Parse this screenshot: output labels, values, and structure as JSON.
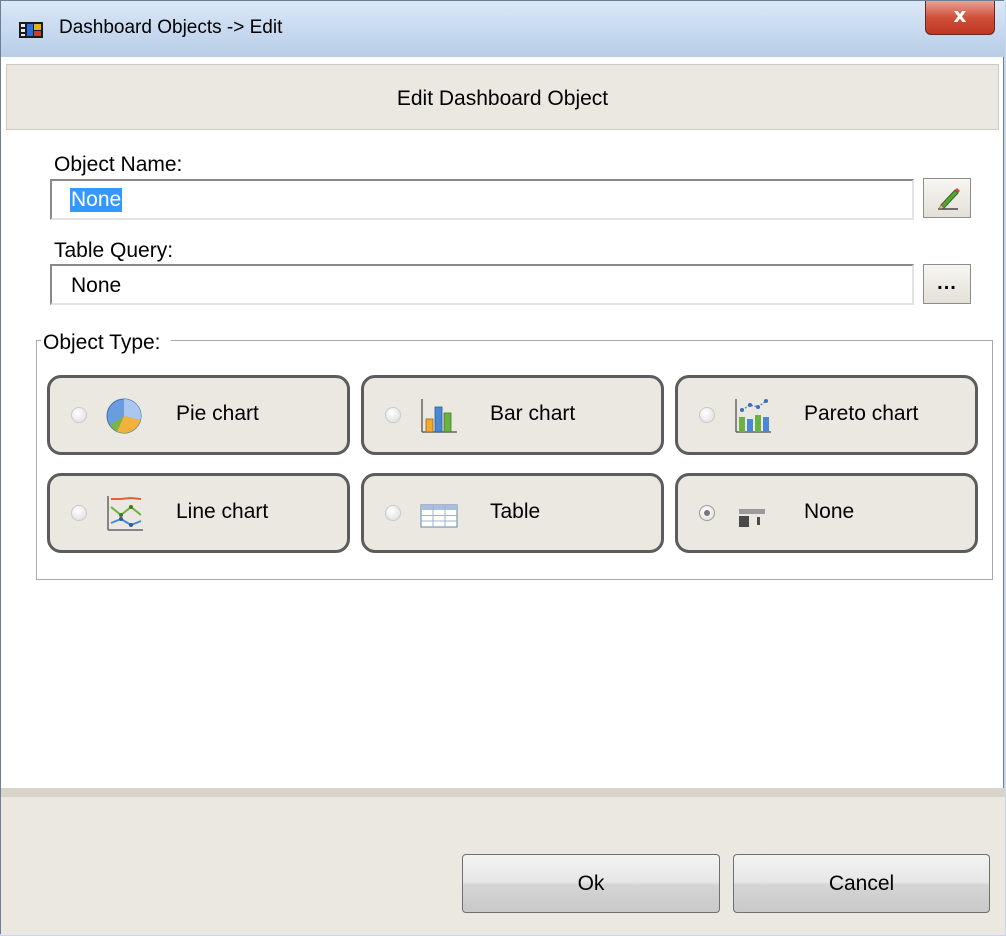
{
  "window": {
    "title": "Dashboard Objects -> Edit",
    "close_label": "x"
  },
  "header": {
    "title": "Edit Dashboard Object"
  },
  "object_name": {
    "label": "Object Name:",
    "value": "None",
    "edit_icon": "pencil-icon"
  },
  "table_query": {
    "label": "Table Query:",
    "value": "None",
    "browse_label": "..."
  },
  "object_type": {
    "label": "Object Type:",
    "options": [
      {
        "label": "Pie chart",
        "icon": "pie-chart-icon",
        "selected": false
      },
      {
        "label": "Bar chart",
        "icon": "bar-chart-icon",
        "selected": false
      },
      {
        "label": "Pareto chart",
        "icon": "pareto-chart-icon",
        "selected": false
      },
      {
        "label": "Line chart",
        "icon": "line-chart-icon",
        "selected": false
      },
      {
        "label": "Table",
        "icon": "table-icon",
        "selected": false
      },
      {
        "label": "None",
        "icon": "none-object-icon",
        "selected": true
      }
    ]
  },
  "footer": {
    "ok_label": "Ok",
    "cancel_label": "Cancel"
  },
  "colors": {
    "selection": "#3399ff",
    "panel": "#ebe8e1",
    "close_button": "#c9432c"
  }
}
